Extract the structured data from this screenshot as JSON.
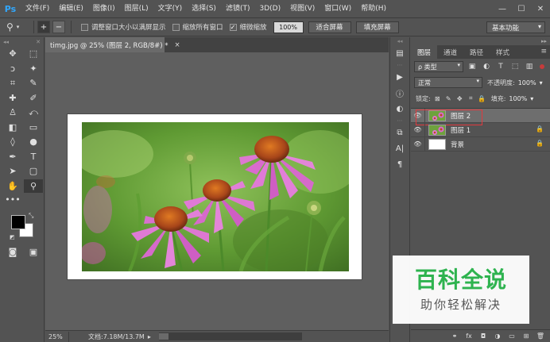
{
  "app": {
    "logo": "Ps"
  },
  "menu": [
    "文件(F)",
    "编辑(E)",
    "图像(I)",
    "图层(L)",
    "文字(Y)",
    "选择(S)",
    "滤镜(T)",
    "3D(D)",
    "视图(V)",
    "窗口(W)",
    "帮助(H)"
  ],
  "window_controls": {
    "minimize": "—",
    "maximize": "☐",
    "close": "✕"
  },
  "options": {
    "tool_icon": "zoom-icon",
    "zoom_in": "+",
    "zoom_out": "−",
    "resize_windows": {
      "label": "调整窗口大小以满屏显示",
      "checked": false
    },
    "zoom_all": {
      "label": "缩放所有窗口",
      "checked": false
    },
    "scrubby_zoom": {
      "label": "细微缩放",
      "checked": true
    },
    "zoom_value": "100%",
    "fit_screen": "适合屏幕",
    "fill_screen": "填充屏幕",
    "workspace": "基本功能"
  },
  "document": {
    "tab_title": "timg.jpg @ 25% (图层 2, RGB/8#) *",
    "tab_close": "×",
    "zoom": "25%",
    "doc_info": "文档:7.18M/13.7M",
    "status_arrow": "▸"
  },
  "toolbar": {
    "tools": [
      {
        "name": "move-tool-icon",
        "glyph": "✥"
      },
      {
        "name": "marquee-tool-icon",
        "glyph": "⬚"
      },
      {
        "name": "lasso-tool-icon",
        "glyph": "ↄ"
      },
      {
        "name": "magic-wand-tool-icon",
        "glyph": "✦"
      },
      {
        "name": "crop-tool-icon",
        "glyph": "⌗"
      },
      {
        "name": "eyedropper-tool-icon",
        "glyph": "✎"
      },
      {
        "name": "healing-brush-tool-icon",
        "glyph": "✚"
      },
      {
        "name": "brush-tool-icon",
        "glyph": "✐"
      },
      {
        "name": "clone-stamp-tool-icon",
        "glyph": "♙"
      },
      {
        "name": "history-brush-tool-icon",
        "glyph": "⤺"
      },
      {
        "name": "eraser-tool-icon",
        "glyph": "◧"
      },
      {
        "name": "gradient-tool-icon",
        "glyph": "▭"
      },
      {
        "name": "blur-tool-icon",
        "glyph": "◊"
      },
      {
        "name": "dodge-tool-icon",
        "glyph": "●"
      },
      {
        "name": "pen-tool-icon",
        "glyph": "✒"
      },
      {
        "name": "type-tool-icon",
        "glyph": "T"
      },
      {
        "name": "path-selection-tool-icon",
        "glyph": "➤"
      },
      {
        "name": "rectangle-tool-icon",
        "glyph": "▢"
      },
      {
        "name": "hand-tool-icon",
        "glyph": "✋"
      },
      {
        "name": "zoom-tool-icon",
        "glyph": "⚲"
      }
    ],
    "more": "•••",
    "quick_mask": "◙",
    "screen_mode": "▣"
  },
  "minicol": [
    {
      "name": "history-panel-icon",
      "glyph": "▤"
    },
    {
      "name": "actions-play-icon",
      "glyph": "▶"
    },
    {
      "name": "info-panel-icon",
      "glyph": "ⓘ"
    },
    {
      "name": "adjustments-panel-icon",
      "glyph": "◐"
    },
    {
      "name": "clone-source-panel-icon",
      "glyph": "⧉"
    },
    {
      "name": "character-panel-icon",
      "glyph": "A|"
    },
    {
      "name": "paragraph-panel-icon",
      "glyph": "¶"
    }
  ],
  "layers_panel": {
    "tabs": [
      "图层",
      "通道",
      "路径",
      "样式"
    ],
    "active_tab": 0,
    "filter": "ρ 类型",
    "blend_mode": "正常",
    "opacity_label": "不透明度:",
    "opacity_value": "100%",
    "lock_label": "锁定:",
    "fill_label": "填充:",
    "fill_value": "100%",
    "layers": [
      {
        "name": "图层 2",
        "selected": true,
        "locked": false,
        "thumb": "photo"
      },
      {
        "name": "图层 1",
        "selected": false,
        "locked": true,
        "thumb": "photo"
      },
      {
        "name": "背景",
        "selected": false,
        "locked": true,
        "thumb": "white"
      }
    ],
    "footer_icons": [
      "link-icon",
      "fx-icon",
      "mask-icon",
      "adjustment-layer-icon",
      "group-icon",
      "new-layer-icon",
      "trash-icon"
    ],
    "footer_glyphs": [
      "⚭",
      "fx",
      "◘",
      "◑",
      "▭",
      "⊞",
      "🗑"
    ]
  },
  "watermark": {
    "title": "百科全说",
    "subtitle": "助你轻松解决"
  }
}
